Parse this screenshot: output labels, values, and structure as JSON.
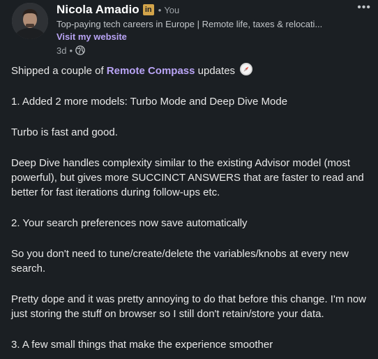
{
  "author": {
    "name": "Nicola Amadio",
    "badge": "in",
    "separator": "•",
    "degree": "You",
    "headline": "Top-paying tech careers in Europe | Remote life, taxes & relocati...",
    "website_link": "Visit my website",
    "time": "3d",
    "meta_separator": "•",
    "visibility_icon": "globe-icon"
  },
  "menu": {
    "more_label": "•••"
  },
  "post": {
    "line1_before": "Shipped a couple of",
    "line1_mention": "Remote Compass",
    "line1_after": "updates",
    "line1_icon": "compass-emoji-icon",
    "p2": "1. Added 2 more models: Turbo Mode and Deep Dive Mode",
    "p3": "Turbo is fast and good.",
    "p4": "Deep Dive handles complexity similar to the existing Advisor model (most powerful), but gives more SUCCINCT ANSWERS that are faster to read and better for fast iterations during follow-ups etc.",
    "p5": "2. Your search preferences now save automatically",
    "p6": "So you don't need to tune/create/delete the variables/knobs at every new search.",
    "p7": "Pretty dope and it was pretty annoying to do that before this change. I'm now just storing the stuff on browser so I still don't retain/store your data.",
    "p8": "3. A few small things that make the experience smoother"
  },
  "colors": {
    "background": "#1b1f23",
    "link": "#b9a4f5",
    "badge": "#d3a44a"
  }
}
